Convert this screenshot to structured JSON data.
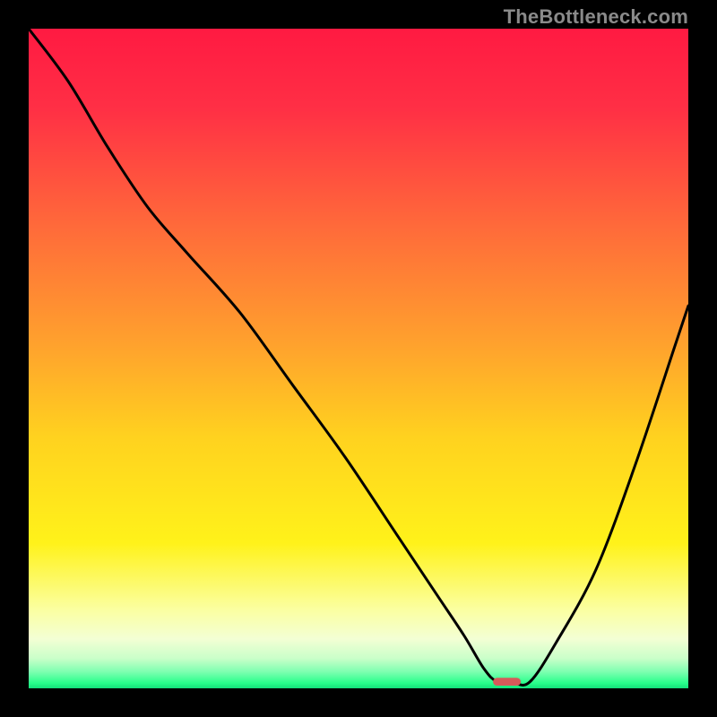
{
  "watermark": "TheBottleneck.com",
  "chart_data": {
    "type": "line",
    "title": "",
    "xlabel": "",
    "ylabel": "",
    "xlim": [
      0,
      100
    ],
    "ylim": [
      0,
      100
    ],
    "grid": false,
    "legend": false,
    "gradient": {
      "stops": [
        {
          "offset": 0.0,
          "color": "#ff1a42"
        },
        {
          "offset": 0.12,
          "color": "#ff2f45"
        },
        {
          "offset": 0.3,
          "color": "#ff6a3a"
        },
        {
          "offset": 0.48,
          "color": "#ffa22d"
        },
        {
          "offset": 0.62,
          "color": "#ffd21f"
        },
        {
          "offset": 0.78,
          "color": "#fff21a"
        },
        {
          "offset": 0.88,
          "color": "#fbffa0"
        },
        {
          "offset": 0.925,
          "color": "#f3ffd4"
        },
        {
          "offset": 0.955,
          "color": "#c9ffc9"
        },
        {
          "offset": 0.975,
          "color": "#7dffb0"
        },
        {
          "offset": 0.992,
          "color": "#28ff8b"
        },
        {
          "offset": 1.0,
          "color": "#14e07a"
        }
      ]
    },
    "curve": {
      "description": "Bottleneck-style V curve. y is % height from top (0=top, 100=bottom).",
      "x": [
        0,
        6,
        12,
        18,
        24,
        32,
        40,
        48,
        56,
        62,
        66,
        69,
        71,
        73.5,
        76,
        80,
        86,
        92,
        98,
        100
      ],
      "y": [
        0,
        8,
        18,
        27,
        34,
        43,
        54,
        65,
        77,
        86,
        92,
        97,
        99,
        99.2,
        99,
        93,
        82,
        66,
        48,
        42
      ]
    },
    "marker": {
      "description": "Small red pill at curve minimum",
      "x_center": 72.5,
      "y_center": 99.0,
      "width_pct": 4.2,
      "height_pct": 1.2,
      "color": "#d65a5a"
    }
  }
}
